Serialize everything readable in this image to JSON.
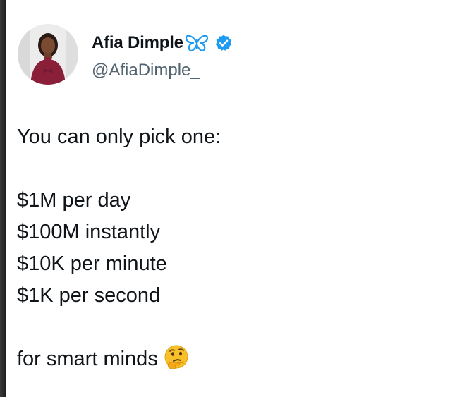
{
  "author": {
    "display_name": "Afia Dimple",
    "handle": "@AfiaDimple_",
    "name_emoji": "butterfly-icon",
    "verified_badge": "verified-badge-icon",
    "avatar": "profile-photo"
  },
  "tweet": {
    "intro": "You can only pick one:",
    "options": [
      "$1M per day",
      "$100M instantly",
      "$10K per minute",
      "$1K per second"
    ],
    "closing": "for smart minds",
    "closing_emoji": "thinking-face-icon"
  },
  "colors": {
    "text": "#0f1419",
    "handle": "#536471",
    "verified": "#1d9bf0",
    "butterfly": "#1d9bf0"
  }
}
